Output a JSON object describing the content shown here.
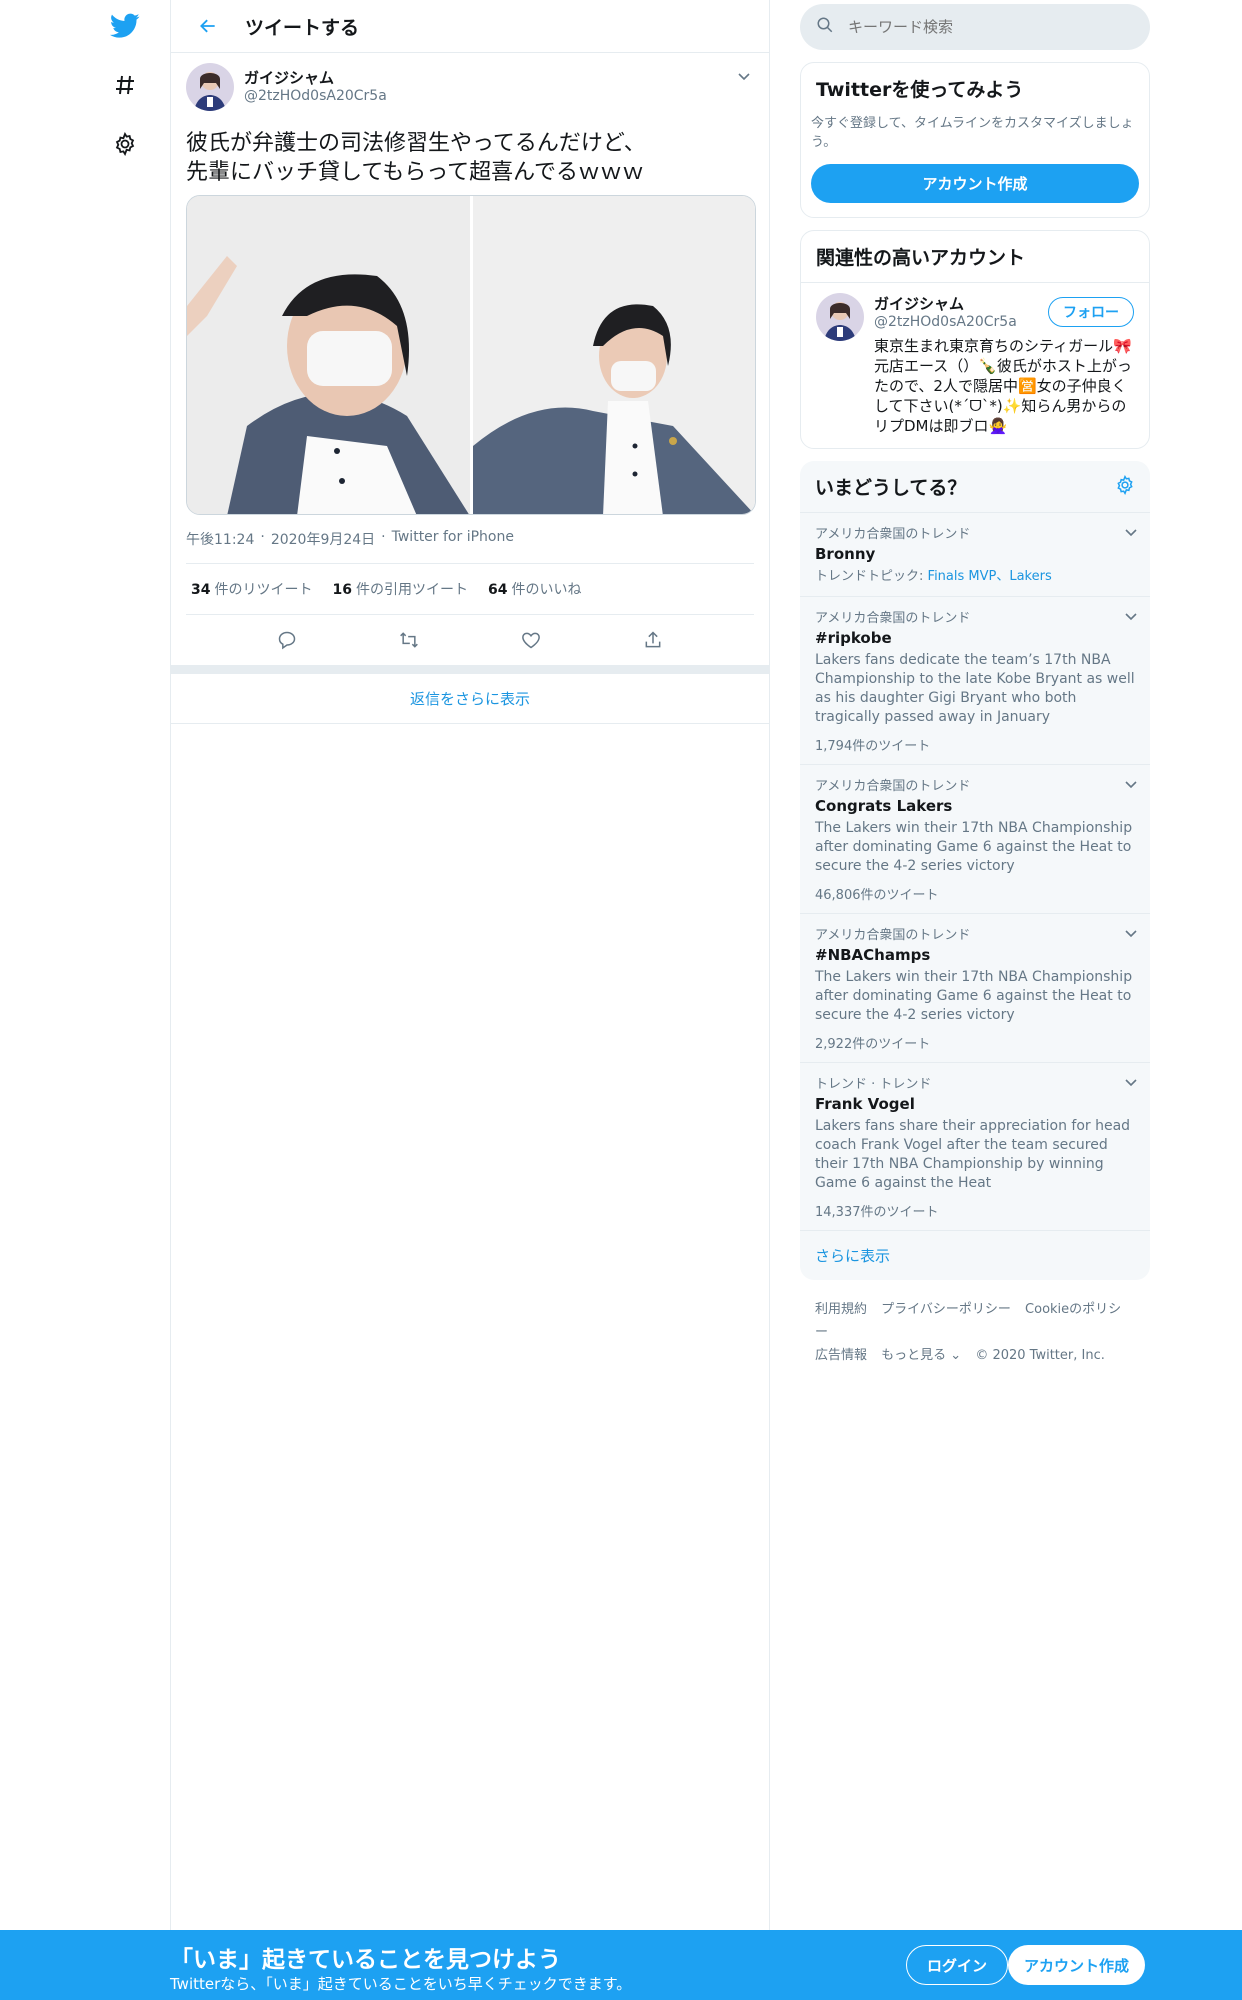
{
  "colors": {
    "brand": "#1da1f2",
    "link": "#1b95e0",
    "muted": "#657786"
  },
  "nav": {
    "icons": [
      "twitter-logo-icon",
      "hashtag-icon",
      "gear-icon"
    ]
  },
  "header": {
    "title": "ツイートする"
  },
  "tweet": {
    "author_name": "ガイジシャム",
    "author_handle": "@2tzHOd0sA20Cr5a",
    "text": "彼氏が弁護士の司法修習生やってるんだけど、\n先輩にバッチ貸してもらって超喜んでるｗｗｗ",
    "time": "午後11:24",
    "date": "2020年9月24日",
    "source": "Twitter for iPhone",
    "sep": "·",
    "retweets": "34",
    "retweets_label": "件のリツイート",
    "quotes": "16",
    "quotes_label": "件の引用ツイート",
    "likes": "64",
    "likes_label": "件のいいね",
    "more_replies": "返信をさらに表示"
  },
  "search": {
    "placeholder": "キーワード検索"
  },
  "signup_card": {
    "title": "Twitterを使ってみよう",
    "desc": "今すぐ登録して、タイムラインをカスタマイズしましょう。",
    "button": "アカウント作成"
  },
  "related": {
    "title": "関連性の高いアカウント",
    "name": "ガイジシャム",
    "handle": "@2tzHOd0sA20Cr5a",
    "follow": "フォロー",
    "bio": "東京生まれ東京育ちのシティガール🎀元店エース（）🍾彼氏がホスト上がったので、2人で隠居中🈺女の子仲良くして下さい(*ˊᗜˋ*)✨知らん男からのリプDMは即ブロ🙅‍♀️"
  },
  "trends": {
    "title": "いまどうしてる？",
    "items": [
      {
        "context": "アメリカ合衆国のトレンド",
        "name": "Bronny",
        "desc": "トレンドトピック:",
        "topics": "Finals MVP、Lakers",
        "count": ""
      },
      {
        "context": "アメリカ合衆国のトレンド",
        "name": "#ripkobe",
        "desc": "Lakers fans dedicate the team’s 17th NBA Championship to the late Kobe Bryant as well as his daughter Gigi Bryant who both tragically passed away in January",
        "topics": "",
        "count": "1,794件のツイート"
      },
      {
        "context": "アメリカ合衆国のトレンド",
        "name": "Congrats Lakers",
        "desc": "The Lakers win their 17th NBA Championship after dominating Game 6 against the Heat to secure the 4-2 series victory",
        "topics": "",
        "count": "46,806件のツイート"
      },
      {
        "context": "アメリカ合衆国のトレンド",
        "name": "#NBAChamps",
        "desc": "The Lakers win their 17th NBA Championship after dominating Game 6 against the Heat to secure the 4-2 series victory",
        "topics": "",
        "count": "2,922件のツイート"
      },
      {
        "context": "トレンド · トレンド",
        "name": "Frank Vogel",
        "desc": "Lakers fans share their appreciation for head coach Frank Vogel after the team secured their 17th NBA Championship by winning Game 6 against the Heat",
        "topics": "",
        "count": "14,337件のツイート"
      }
    ],
    "show_more": "さらに表示"
  },
  "footer": {
    "links": [
      "利用規約",
      "プライバシーポリシー",
      "Cookieのポリシー",
      "広告情報",
      "もっと見る ⌄"
    ],
    "copyright": "© 2020 Twitter, Inc."
  },
  "banner": {
    "title": "「いま」起きていることを見つけよう",
    "sub": "Twitterなら、「いま」起きていることをいち早くチェックできます。",
    "login": "ログイン",
    "signup": "アカウント作成"
  }
}
